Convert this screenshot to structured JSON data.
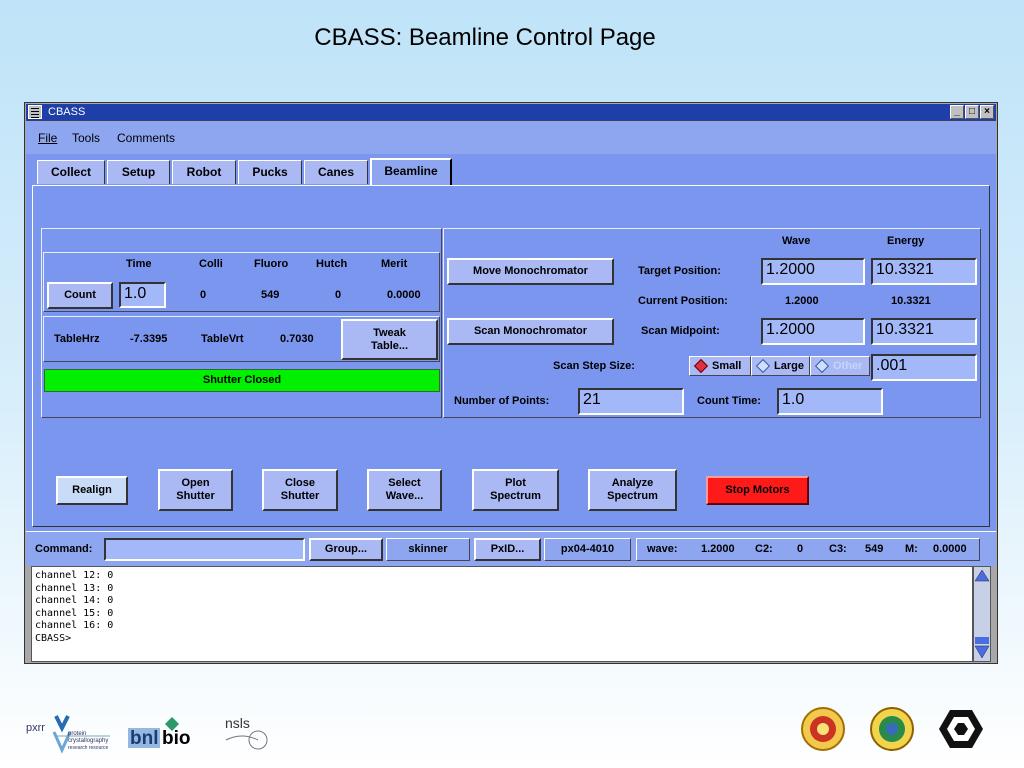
{
  "slide": {
    "title": "CBASS: Beamline Control Page"
  },
  "window": {
    "title": "CBASS",
    "controls": [
      "_",
      "□",
      "×"
    ]
  },
  "menu": {
    "file": "File",
    "tools": "Tools",
    "comments": "Comments"
  },
  "tabs": [
    "Collect",
    "Setup",
    "Robot",
    "Pucks",
    "Canes",
    "Beamline"
  ],
  "counts": {
    "headers": [
      "Time",
      "Colli",
      "Fluoro",
      "Hutch",
      "Merit"
    ],
    "count_button": "Count",
    "time_value": "1.0",
    "colli": "0",
    "fluoro": "549",
    "hutch": "0",
    "merit": "0.0000"
  },
  "table": {
    "hrz_label": "TableHrz",
    "hrz_value": "-7.3395",
    "vrt_label": "TableVrt",
    "vrt_value": "0.7030",
    "tweak_button": "Tweak Table..."
  },
  "shutter_status": {
    "text": "Shutter Closed",
    "color": "#00f000"
  },
  "mono": {
    "wave_header": "Wave",
    "energy_header": "Energy",
    "move_button": "Move Monochromator",
    "target_label": "Target Position:",
    "target_wave": "1.2000",
    "target_energy": "10.3321",
    "current_label": "Current Position:",
    "current_wave": "1.2000",
    "current_energy": "10.3321",
    "scan_button": "Scan Monochromator",
    "midpoint_label": "Scan Midpoint:",
    "midpoint_wave": "1.2000",
    "midpoint_energy": "10.3321",
    "step_label": "Scan Step Size:",
    "step_small": "Small",
    "step_large": "Large",
    "step_other": "Other",
    "step_value": ".001",
    "points_label": "Number of Points:",
    "points_value": "21",
    "count_time_label": "Count Time:",
    "count_time_value": "1.0"
  },
  "actions": {
    "realign": "Realign",
    "open_shutter": "Open Shutter",
    "close_shutter": "Close Shutter",
    "select_wave": "Select Wave...",
    "plot_spectrum": "Plot Spectrum",
    "analyze_spectrum": "Analyze Spectrum",
    "stop_motors": "Stop Motors",
    "stop_color": "#ff1a1a"
  },
  "status": {
    "command_label": "Command:",
    "command_value": "",
    "group_button": "Group...",
    "user": "skinner",
    "pxid_button": "PxID...",
    "host": "px04-4010",
    "wave_label": "wave:",
    "wave_value": "1.2000",
    "c2_label": "C2:",
    "c2_value": "0",
    "c3_label": "C3:",
    "c3_value": "549",
    "m_label": "M:",
    "m_value": "0.0000"
  },
  "console": {
    "lines": [
      "channel 12: 0",
      "channel 13: 0",
      "channel 14: 0",
      "channel 15: 0",
      "channel 16: 0",
      "CBASS>"
    ]
  },
  "logos": {
    "pxrr": "pxrr",
    "pxrr_sub1": "protein",
    "pxrr_sub2": "crystallography",
    "pxrr_sub3": "research resource",
    "bnl": "bnl",
    "bio": "bio",
    "nsls": "nsls"
  }
}
